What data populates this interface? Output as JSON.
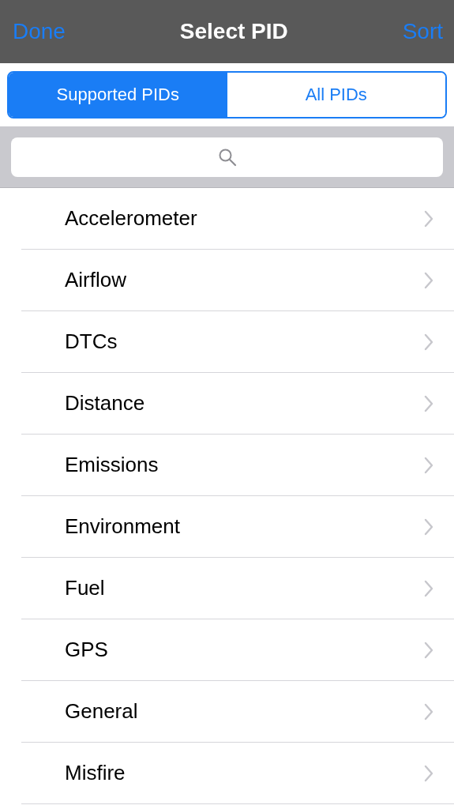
{
  "nav_bar": {
    "left_button": "Done",
    "title": "Select PID",
    "right_button": "Sort"
  },
  "segments": [
    {
      "label": "Supported PIDs",
      "selected": true
    },
    {
      "label": "All PIDs",
      "selected": false
    }
  ],
  "categories": [
    {
      "label": "Accelerometer"
    },
    {
      "label": "Airflow"
    },
    {
      "label": "DTCs"
    },
    {
      "label": "Distance"
    },
    {
      "label": "Emissions"
    },
    {
      "label": "Environment"
    },
    {
      "label": "Fuel"
    },
    {
      "label": "GPS"
    },
    {
      "label": "General"
    },
    {
      "label": "Misfire"
    }
  ]
}
